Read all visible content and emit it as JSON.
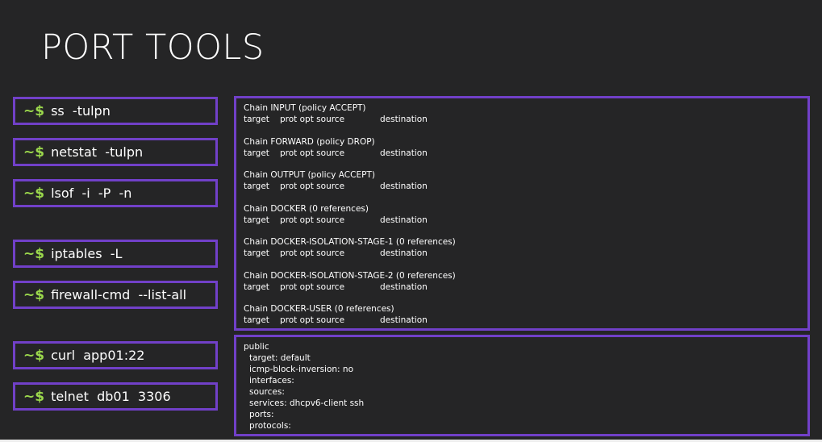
{
  "title": "PORT TOOLS",
  "prompt": "~$",
  "commands": [
    {
      "text": "ss  -tulpn"
    },
    {
      "text": "netstat  -tulpn"
    },
    {
      "text": "lsof  -i  -P  -n"
    },
    {
      "text": "iptables  -L"
    },
    {
      "text": "firewall-cmd  --list-all"
    },
    {
      "text": "curl  app01:22"
    },
    {
      "text": "telnet  db01  3306"
    }
  ],
  "iptables_output": {
    "columns": {
      "target": "target",
      "prot": "prot opt source",
      "destination": "destination"
    },
    "chains": [
      "Chain INPUT (policy ACCEPT)",
      "Chain FORWARD (policy DROP)",
      "Chain OUTPUT (policy ACCEPT)",
      "Chain DOCKER (0 references)",
      "Chain DOCKER-ISOLATION-STAGE-1 (0 references)",
      "Chain DOCKER-ISOLATION-STAGE-2 (0 references)",
      "Chain DOCKER-USER (0 references)"
    ]
  },
  "firewall_output": {
    "zone": "public",
    "lines": [
      "target: default",
      "icmp-block-inversion: no",
      "interfaces:",
      "sources:",
      "services: dhcpv6-client ssh",
      "ports:",
      "protocols:"
    ]
  },
  "colors": {
    "background": "#252526",
    "border": "#7140c8",
    "prompt": "#9bd84c",
    "text": "#ffffff"
  }
}
